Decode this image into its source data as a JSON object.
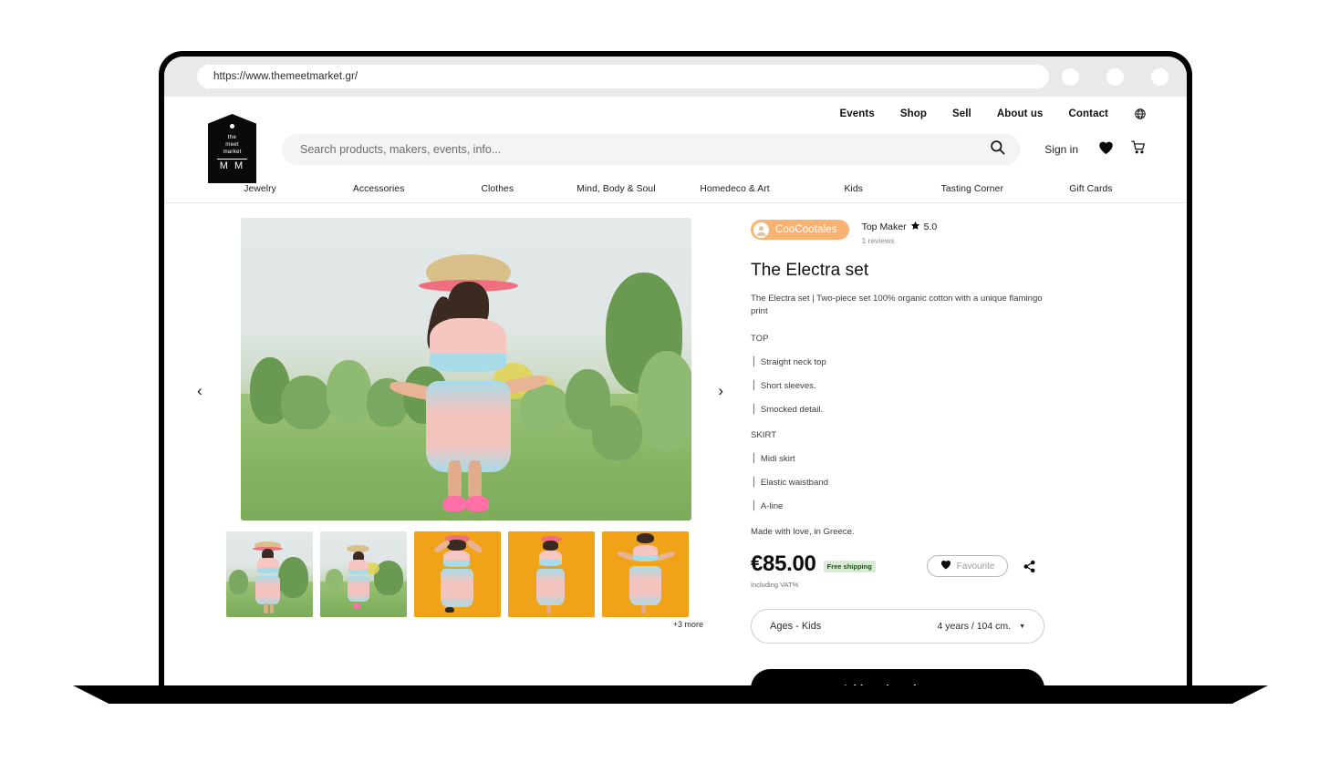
{
  "browser": {
    "url": "https://www.themeetmarket.gr/",
    "dots": 3
  },
  "header": {
    "top_links": [
      "Events",
      "Shop",
      "Sell",
      "About us",
      "Contact"
    ],
    "globe_icon": "globe-icon",
    "logo": {
      "line1": "the",
      "line2": "meet",
      "line3": "market",
      "monogram": "M M"
    },
    "search_placeholder": "Search products, makers, events, info...",
    "search_value": "",
    "search_icon": "search-icon",
    "sign_in": "Sign in",
    "wishlist_icon": "heart-icon",
    "cart_icon": "cart-icon"
  },
  "categories": [
    "Jewelry",
    "Accessories",
    "Clothes",
    "Mind, Body & Soul",
    "Homedeco & Art",
    "Kids",
    "Tasting Corner",
    "Gift Cards"
  ],
  "gallery": {
    "prev_icon": "chevron-left-icon",
    "next_icon": "chevron-right-icon",
    "more_label": "+3 more",
    "thumbnails": [
      {
        "name": "thumb-outdoor-standing",
        "scene": "outdoor"
      },
      {
        "name": "thumb-outdoor-walking",
        "scene": "outdoor2"
      },
      {
        "name": "thumb-studio-arms-up",
        "scene": "studio"
      },
      {
        "name": "thumb-studio-side",
        "scene": "studio2"
      },
      {
        "name": "thumb-studio-front",
        "scene": "studio3"
      }
    ]
  },
  "product": {
    "maker": {
      "name": "CooCootales",
      "badge_label": "Top Maker",
      "star_icon": "star-icon",
      "rating": "5.0",
      "reviews": "1 reviews"
    },
    "title": "The Electra set",
    "description": "The Electra set | Two-piece set 100% organic cotton with a unique flamingo print",
    "spec_groups": [
      {
        "heading": "TOP",
        "items": [
          "Straight neck top",
          "Short sleeves.",
          "Smocked detail."
        ]
      },
      {
        "heading": "SKIRT",
        "items": [
          "Midi skirt",
          "Elastic waistband",
          "A-line"
        ]
      }
    ],
    "made_in": "Made with love, in Greece.",
    "price": "€85.00",
    "shipping_badge": "Free shipping",
    "vat_note": "Including VAT%",
    "favourite_label": "Favourite",
    "favourite_icon": "heart-icon",
    "share_icon": "share-icon",
    "size_label": "Ages - Kids",
    "size_value": "4 years / 104 cm.",
    "size_caret_icon": "chevron-down-icon",
    "add_to_cart": "Add to shopping cart"
  },
  "colors": {
    "accent_orange": "#F8B372",
    "shipping_badge_bg": "#d8ecd3",
    "shipping_badge_text": "#1d4f1a",
    "cta_bg": "#000000",
    "studio_bg": "#f0a319"
  }
}
